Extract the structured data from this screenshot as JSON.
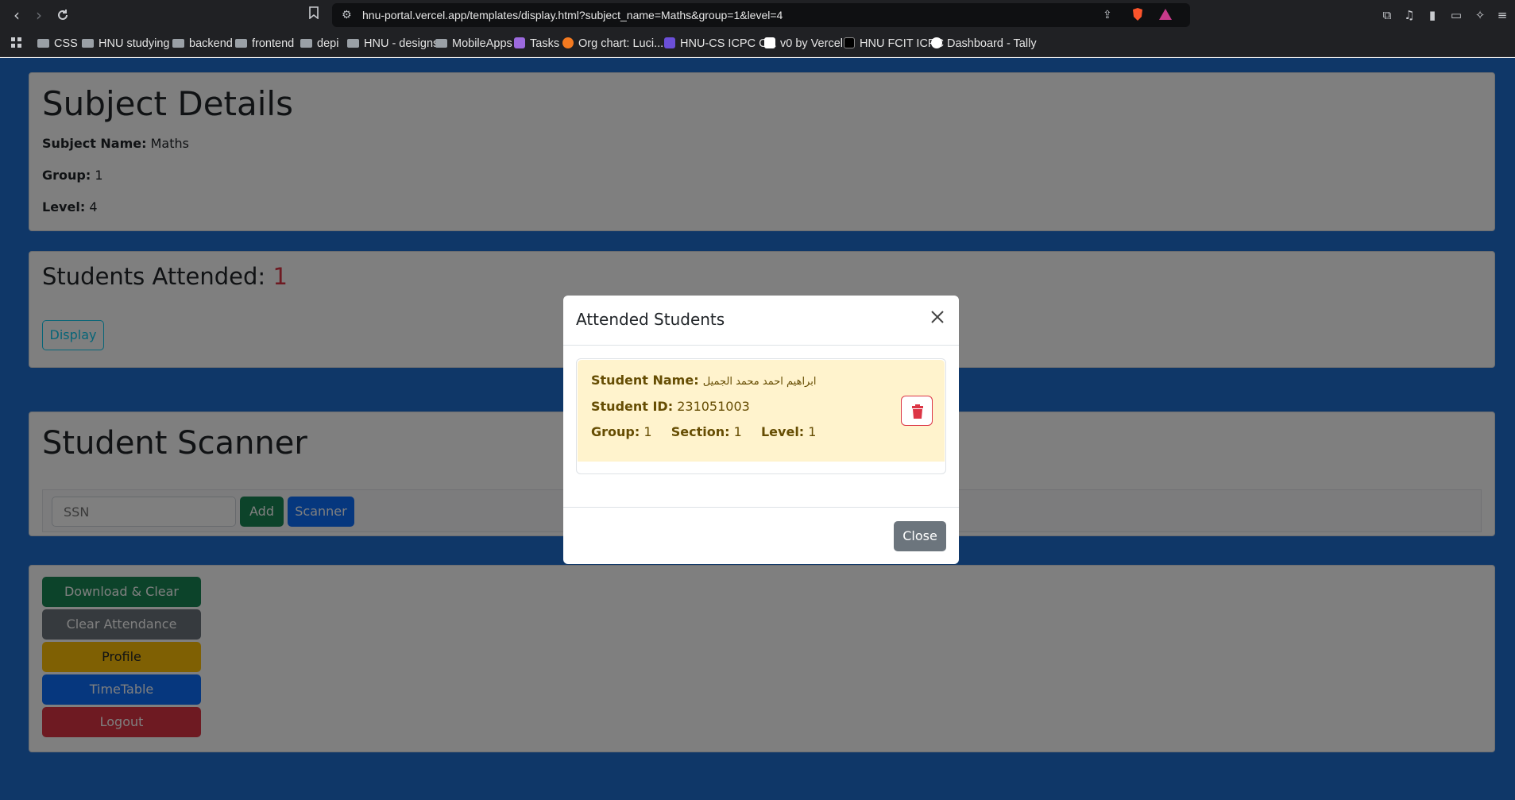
{
  "browser": {
    "url": "hnu-portal.vercel.app/templates/display.html?subject_name=Maths&group=1&level=4",
    "bookmarks": [
      {
        "label": "CSS",
        "icon": "folder-icon"
      },
      {
        "label": "HNU studying",
        "icon": "folder-icon"
      },
      {
        "label": "backend",
        "icon": "folder-icon"
      },
      {
        "label": "frontend",
        "icon": "folder-icon"
      },
      {
        "label": "depi",
        "icon": "folder-icon"
      },
      {
        "label": "HNU - designs",
        "icon": "folder-icon"
      },
      {
        "label": "MobileApps",
        "icon": "folder-icon"
      },
      {
        "label": "Tasks",
        "icon": "tasks-icon"
      },
      {
        "label": "Org chart: Luci...",
        "icon": "org-chart-icon"
      },
      {
        "label": "HNU-CS ICPC C...",
        "icon": "icpc-icon"
      },
      {
        "label": "v0 by Vercel",
        "icon": "v0-icon"
      },
      {
        "label": "HNU FCIT ICPC",
        "icon": "vercel-icon"
      },
      {
        "label": "Dashboard - Tally",
        "icon": "tally-icon"
      }
    ]
  },
  "subject": {
    "heading": "Subject Details",
    "name_label": "Subject Name:",
    "name_value": "Maths",
    "group_label": "Group:",
    "group_value": "1",
    "level_label": "Level:",
    "level_value": "4"
  },
  "attendance": {
    "heading": "Students Attended:",
    "count": "1",
    "display_button": "Display"
  },
  "scanner": {
    "heading": "Student Scanner",
    "ssn_placeholder": "SSN",
    "add_button": "Add",
    "scanner_button": "Scanner"
  },
  "actions": {
    "download_clear": "Download & Clear",
    "clear_attendance": "Clear Attendance",
    "profile": "Profile",
    "timetable": "TimeTable",
    "logout": "Logout"
  },
  "modal": {
    "title": "Attended Students",
    "close_button": "Close",
    "student": {
      "name_label": "Student Name:",
      "name_value": "ابراهيم احمد محمد الجميل",
      "id_label": "Student ID:",
      "id_value": "231051003",
      "group_label": "Group:",
      "group_value": "1",
      "section_label": "Section:",
      "section_value": "1",
      "level_label": "Level:",
      "level_value": "1"
    }
  },
  "colors": {
    "success": "#198754",
    "secondary": "#6c757d",
    "warning": "#ffc107",
    "primary": "#0d6efd",
    "danger": "#dc3545",
    "info": "#0dcaf0"
  }
}
